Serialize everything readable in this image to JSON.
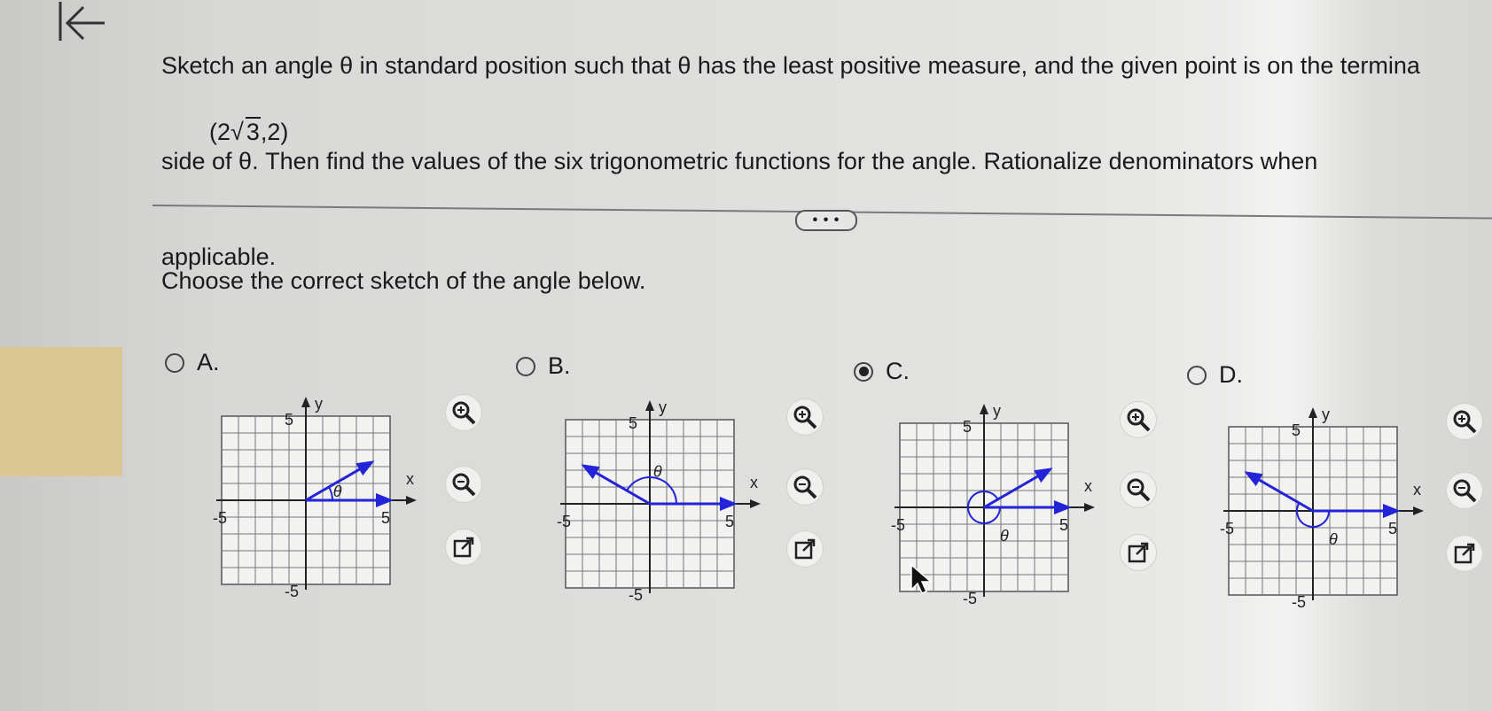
{
  "question": {
    "line1": "Sketch an angle θ in standard position such that θ has the least positive measure, and the given point is on the termina",
    "line2": "side of θ. Then find the values of the six trigonometric functions for the angle. Rationalize denominators when",
    "line3": "applicable.",
    "point_prefix": "(2",
    "point_root": "3",
    "point_suffix": ",2)"
  },
  "more_label": "• • •",
  "prompt": "Choose the correct sketch of the angle below.",
  "selected_choice": "C",
  "choices": [
    {
      "letter": "A.",
      "selected": false,
      "graph": {
        "x_label": "x",
        "y_label": "y",
        "tick_neg": "-5",
        "tick_pos": "5",
        "theta": "θ"
      }
    },
    {
      "letter": "B.",
      "selected": false,
      "graph": {
        "x_label": "x",
        "y_label": "y",
        "tick_neg": "-5",
        "tick_pos": "5",
        "theta": "θ"
      }
    },
    {
      "letter": "C.",
      "selected": true,
      "graph": {
        "x_label": "x",
        "y_label": "y",
        "tick_neg": "-5",
        "tick_pos": "5",
        "theta": "θ"
      }
    },
    {
      "letter": "D.",
      "selected": false,
      "graph": {
        "x_label": "x",
        "y_label": "y",
        "tick_neg": "-5",
        "tick_pos": "5",
        "theta": "θ"
      }
    }
  ],
  "icons": {
    "back": "back-arrow-icon",
    "zoom_in": "zoom-in-icon",
    "zoom_out": "zoom-out-icon",
    "popout": "external-link-icon"
  },
  "colors": {
    "ray": "#2323d8",
    "selected_radio": "#222222"
  }
}
